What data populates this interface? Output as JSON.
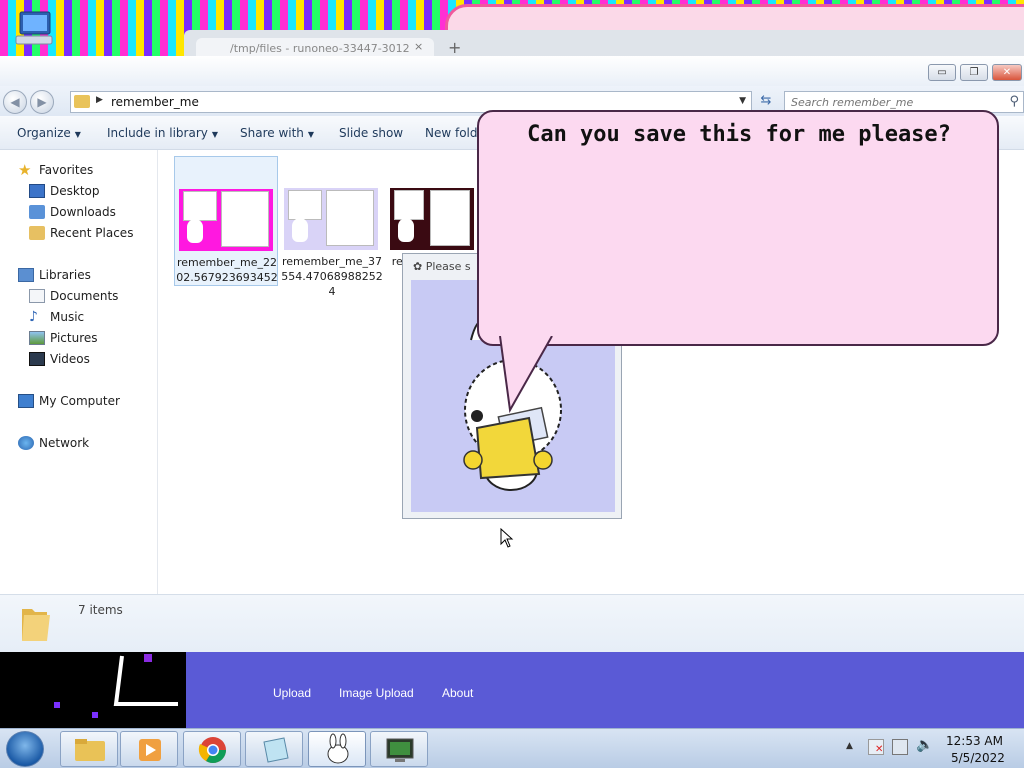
{
  "browser": {
    "tab_title": "/tmp/files - runoneo-33447-3012",
    "close_glyph": "×",
    "new_tab_glyph": "+"
  },
  "window": {
    "minimize": "▭",
    "maximize": "❐",
    "close": "✕"
  },
  "address": {
    "back": "◀",
    "forward": "▶",
    "path": "remember_me",
    "search_placeholder": "Search remember_me"
  },
  "toolbar": {
    "organize": "Organize",
    "include_in_library": "Include in library",
    "share_with": "Share with",
    "slide_show": "Slide show",
    "new_folder": "New folder"
  },
  "nav": {
    "favorites": "Favorites",
    "desktop": "Desktop",
    "downloads": "Downloads",
    "recent_places": "Recent Places",
    "libraries": "Libraries",
    "documents": "Documents",
    "music": "Music",
    "pictures": "Pictures",
    "videos": "Videos",
    "my_computer": "My Computer",
    "network": "Network"
  },
  "files": [
    {
      "name": "remember_me_2202.567923693452",
      "bg": "#ff18e0"
    },
    {
      "name": "remember_me_37554.470689882524",
      "bg": "#d9d3f7"
    },
    {
      "name": "re 84",
      "bg": "#3a0a12"
    }
  ],
  "status": {
    "item_count": "7 items"
  },
  "dialog": {
    "title": "Please s"
  },
  "bubble": {
    "text": "Can you save this for me please?"
  },
  "web": {
    "upload": "Upload",
    "image_upload": "Image Upload",
    "about": "About"
  },
  "clock": {
    "time": "12:53 AM",
    "date": "5/5/2022"
  },
  "colors": {
    "bubble_fill": "#fcd9f0",
    "web_strip": "#5a5ad6",
    "dialog_body": "#c8caf4"
  }
}
